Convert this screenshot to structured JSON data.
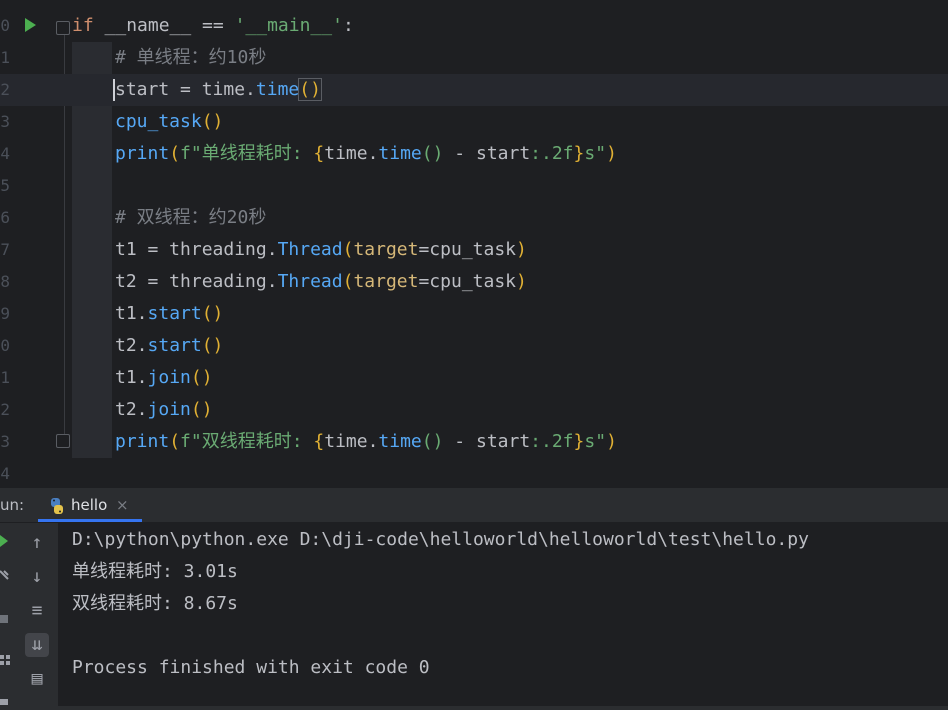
{
  "editor": {
    "lines": [
      {
        "num": "0",
        "tokens": [
          {
            "t": "if",
            "c": "kw"
          },
          {
            "t": " __name__ == ",
            "c": "plain"
          },
          {
            "t": "'__main__'",
            "c": "str"
          },
          {
            "t": ":",
            "c": "plain"
          }
        ]
      },
      {
        "num": "1",
        "tokens": [
          {
            "t": "# 单线程：约10秒",
            "c": "cmt"
          }
        ]
      },
      {
        "num": "2",
        "tokens": [
          {
            "t": "start = time.",
            "c": "plain"
          },
          {
            "t": "time",
            "c": "fn"
          },
          {
            "t": "()",
            "c": "par hlp"
          }
        ]
      },
      {
        "num": "3",
        "tokens": [
          {
            "t": "cpu_task",
            "c": "fn"
          },
          {
            "t": "()",
            "c": "par"
          }
        ]
      },
      {
        "num": "4",
        "tokens": [
          {
            "t": "print",
            "c": "bi"
          },
          {
            "t": "(",
            "c": "par"
          },
          {
            "t": "f\"单线程耗时: ",
            "c": "str"
          },
          {
            "t": "{",
            "c": "par"
          },
          {
            "t": "time.",
            "c": "plain"
          },
          {
            "t": "time",
            "c": "fn"
          },
          {
            "t": "()",
            "c": "par2"
          },
          {
            "t": " - start",
            "c": "plain"
          },
          {
            "t": ":.2f",
            "c": "str"
          },
          {
            "t": "}",
            "c": "par"
          },
          {
            "t": "s\"",
            "c": "str"
          },
          {
            "t": ")",
            "c": "par"
          }
        ]
      },
      {
        "num": "5",
        "tokens": []
      },
      {
        "num": "6",
        "tokens": [
          {
            "t": "# 双线程：约20秒",
            "c": "cmt"
          }
        ]
      },
      {
        "num": "7",
        "tokens": [
          {
            "t": "t1 = threading.",
            "c": "plain"
          },
          {
            "t": "Thread",
            "c": "fn"
          },
          {
            "t": "(",
            "c": "par"
          },
          {
            "t": "target",
            "c": "kwarg"
          },
          {
            "t": "=cpu_task",
            "c": "plain"
          },
          {
            "t": ")",
            "c": "par"
          }
        ]
      },
      {
        "num": "8",
        "tokens": [
          {
            "t": "t2 = threading.",
            "c": "plain"
          },
          {
            "t": "Thread",
            "c": "fn"
          },
          {
            "t": "(",
            "c": "par"
          },
          {
            "t": "target",
            "c": "kwarg"
          },
          {
            "t": "=cpu_task",
            "c": "plain"
          },
          {
            "t": ")",
            "c": "par"
          }
        ]
      },
      {
        "num": "9",
        "tokens": [
          {
            "t": "t1.",
            "c": "plain"
          },
          {
            "t": "start",
            "c": "fn"
          },
          {
            "t": "()",
            "c": "par"
          }
        ]
      },
      {
        "num": "0",
        "tokens": [
          {
            "t": "t2.",
            "c": "plain"
          },
          {
            "t": "start",
            "c": "fn"
          },
          {
            "t": "()",
            "c": "par"
          }
        ]
      },
      {
        "num": "1",
        "tokens": [
          {
            "t": "t1.",
            "c": "plain"
          },
          {
            "t": "join",
            "c": "fn"
          },
          {
            "t": "()",
            "c": "par"
          }
        ]
      },
      {
        "num": "2",
        "tokens": [
          {
            "t": "t2.",
            "c": "plain"
          },
          {
            "t": "join",
            "c": "fn"
          },
          {
            "t": "()",
            "c": "par"
          }
        ]
      },
      {
        "num": "3",
        "tokens": [
          {
            "t": "print",
            "c": "bi"
          },
          {
            "t": "(",
            "c": "par"
          },
          {
            "t": "f\"双线程耗时: ",
            "c": "str"
          },
          {
            "t": "{",
            "c": "par"
          },
          {
            "t": "time.",
            "c": "plain"
          },
          {
            "t": "time",
            "c": "fn"
          },
          {
            "t": "()",
            "c": "par2"
          },
          {
            "t": " - start",
            "c": "plain"
          },
          {
            "t": ":.2f",
            "c": "str"
          },
          {
            "t": "}",
            "c": "par"
          },
          {
            "t": "s\"",
            "c": "str"
          },
          {
            "t": ")",
            "c": "par"
          }
        ]
      },
      {
        "num": "4",
        "tokens": []
      }
    ]
  },
  "run_panel": {
    "label": "un:",
    "tab_label": "hello",
    "tab_close": "×",
    "console_lines": [
      "D:\\python\\python.exe D:\\dji-code\\helloworld\\helloworld\\test\\hello.py",
      "单线程耗时: 3.01s",
      "双线程耗时: 8.67s",
      "",
      "Process finished with exit code 0"
    ]
  },
  "icons": {
    "gutter": "run-icon",
    "toolbar": [
      "up-arrow-icon",
      "down-arrow-icon",
      "soft-wrap-icon",
      "scroll-to-end-icon",
      "print-icon"
    ]
  }
}
